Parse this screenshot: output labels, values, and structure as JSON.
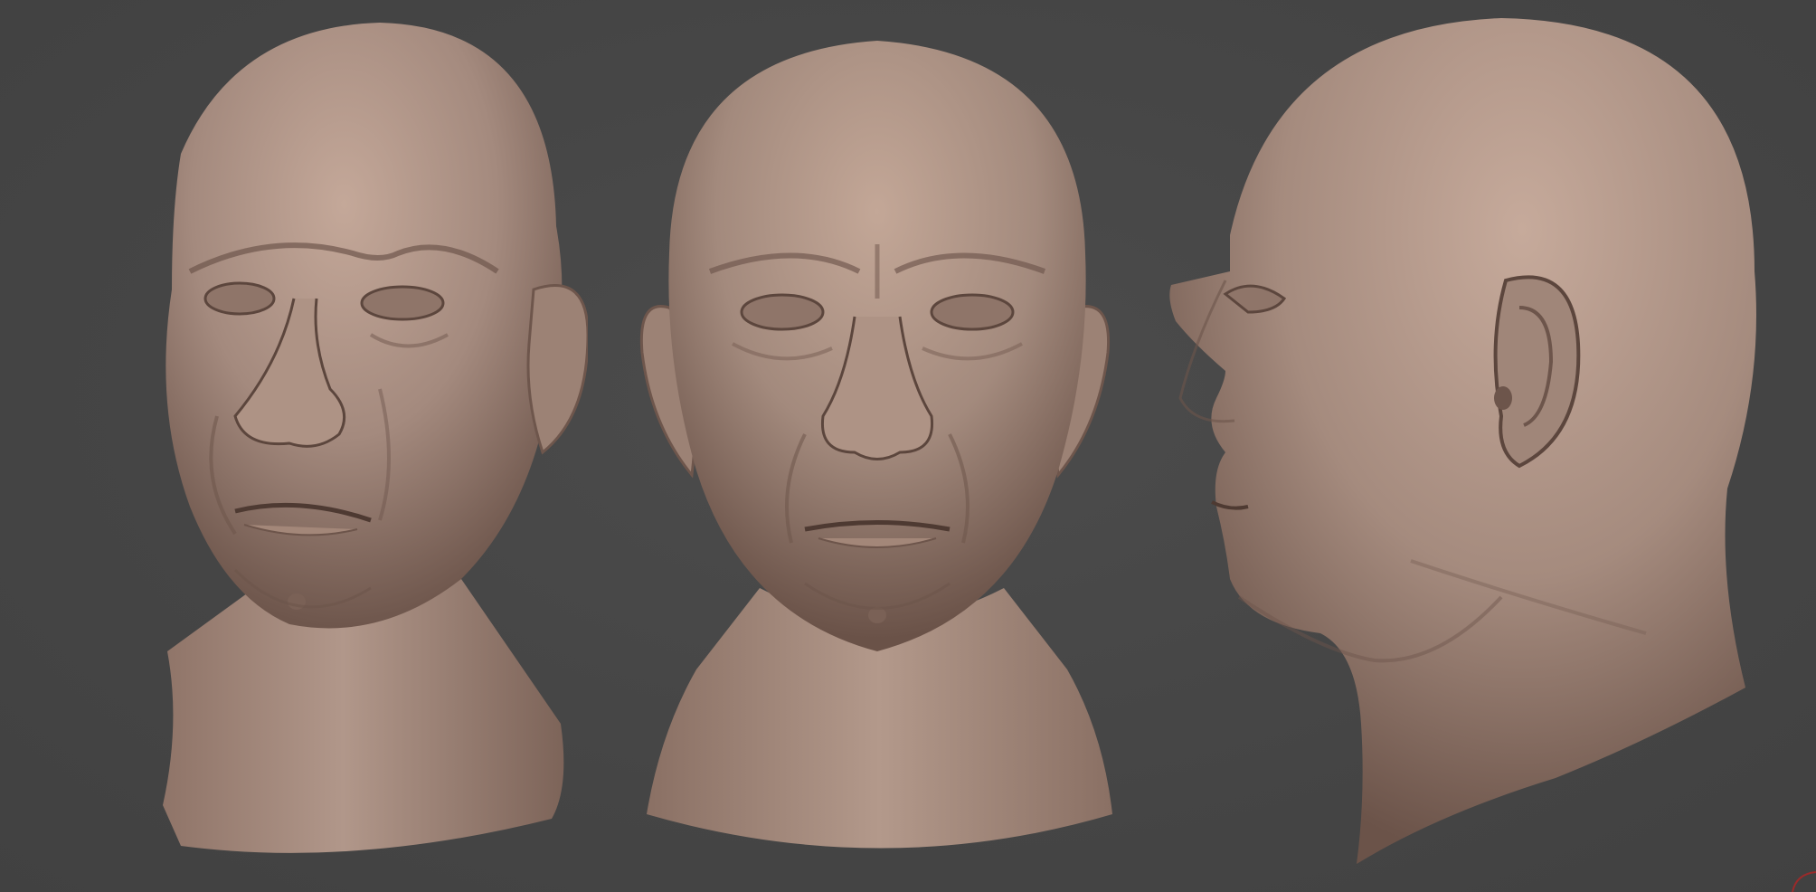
{
  "viewport": {
    "background_color": "#464646"
  },
  "material": {
    "base_color": "#a58a7e",
    "highlight_color": "#c9ad9f",
    "shadow_color": "#5c463d",
    "deep_shadow_color": "#3e2e28"
  },
  "renders": [
    {
      "view": "three-quarter"
    },
    {
      "view": "front"
    },
    {
      "view": "profile"
    }
  ],
  "gizmo": {
    "icon": "view-gizmo-icon",
    "color": "#9a2a2a"
  }
}
